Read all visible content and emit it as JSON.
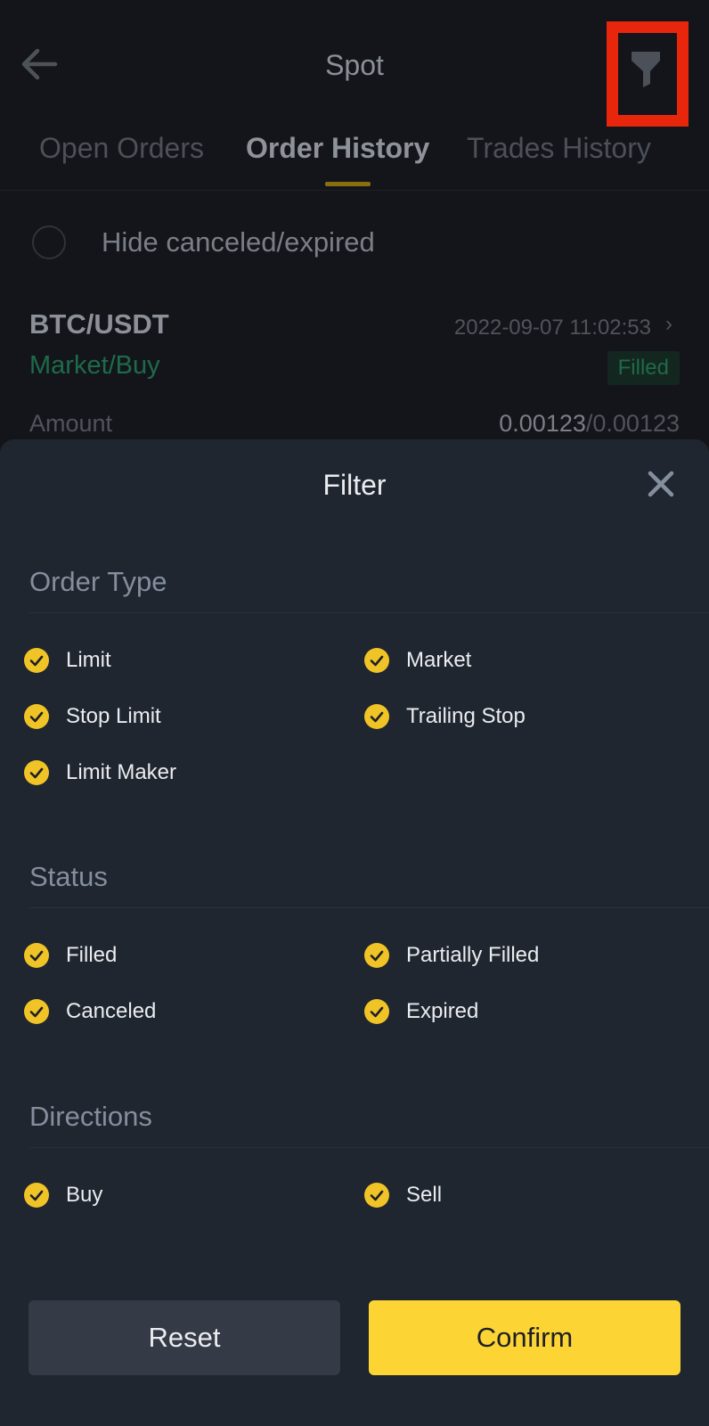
{
  "header": {
    "title": "Spot",
    "back_icon": "arrow-left-icon",
    "filter_icon": "funnel-icon"
  },
  "tabs": [
    {
      "label": "Open Orders",
      "active": false
    },
    {
      "label": "Order History",
      "active": true
    },
    {
      "label": "Trades History",
      "active": false
    }
  ],
  "hide_toggle": {
    "label": "Hide canceled/expired",
    "checked": false
  },
  "order": {
    "pair": "BTC/USDT",
    "time": "2022-09-07 11:02:53",
    "type": "Market/Buy",
    "status": "Filled",
    "amount_label": "Amount",
    "amount_filled": "0.00123",
    "amount_separator": "/",
    "amount_total": "0.00123"
  },
  "filter": {
    "title": "Filter",
    "sections": [
      {
        "title": "Order Type",
        "options": [
          {
            "label": "Limit",
            "checked": true
          },
          {
            "label": "Market",
            "checked": true
          },
          {
            "label": "Stop Limit",
            "checked": true
          },
          {
            "label": "Trailing Stop",
            "checked": true
          },
          {
            "label": "Limit Maker",
            "checked": true
          }
        ]
      },
      {
        "title": "Status",
        "options": [
          {
            "label": "Filled",
            "checked": true
          },
          {
            "label": "Partially Filled",
            "checked": true
          },
          {
            "label": "Canceled",
            "checked": true
          },
          {
            "label": "Expired",
            "checked": true
          }
        ]
      },
      {
        "title": "Directions",
        "options": [
          {
            "label": "Buy",
            "checked": true
          },
          {
            "label": "Sell",
            "checked": true
          }
        ]
      }
    ],
    "reset_label": "Reset",
    "confirm_label": "Confirm"
  },
  "colors": {
    "accent": "#fcd535",
    "buy_green": "#1d6b4a",
    "highlight_red": "#e8260c",
    "sheet_bg": "#202630"
  }
}
